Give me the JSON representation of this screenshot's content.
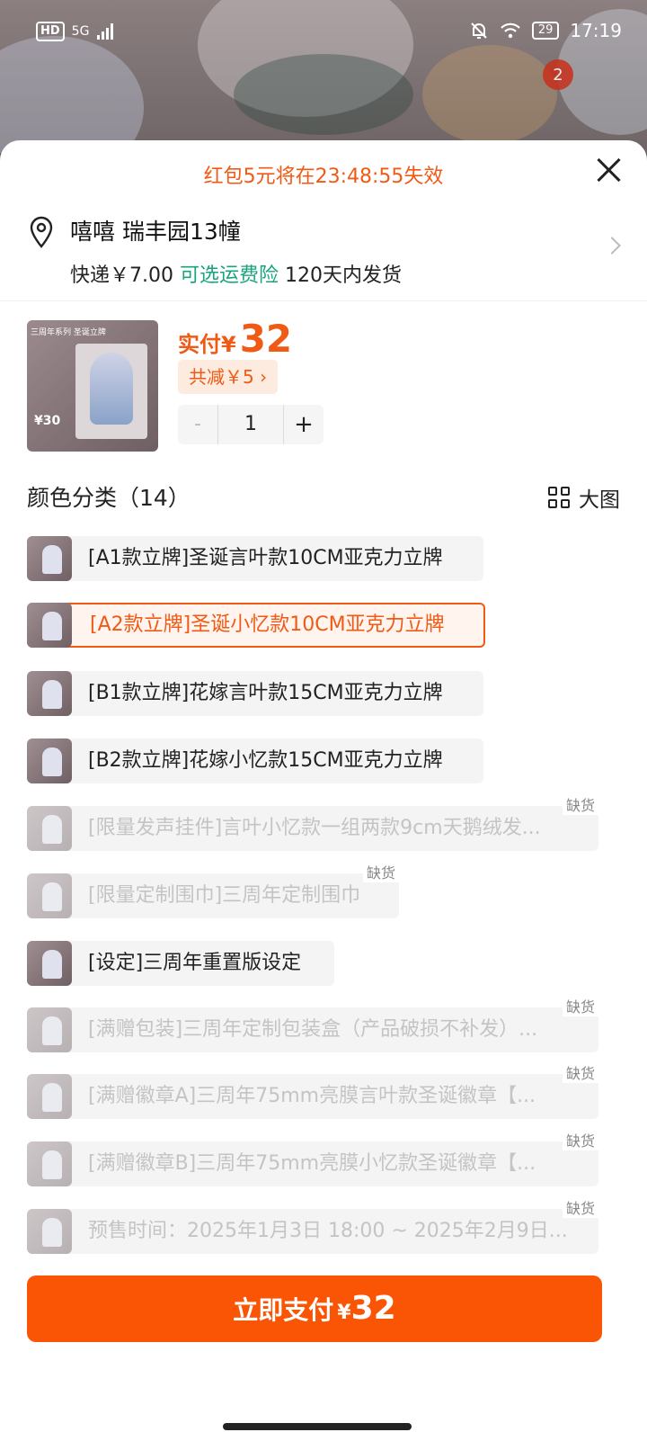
{
  "status_bar": {
    "network_hd": "HD",
    "network_type": "5G",
    "battery": "29",
    "time": "17:19",
    "notification_badge": "2"
  },
  "coupon_notice": "红包5元将在23:48:55失效",
  "address": {
    "name_and_place": "嘻嘻 瑞丰园13幢",
    "shipping_fee": "快递￥7.00",
    "insurance": "可选运费险",
    "dispatch": "120天内发货"
  },
  "product": {
    "thumb_title": "三周年系列 圣诞立牌",
    "thumb_price": "¥30",
    "price_label": "实付",
    "currency": "¥",
    "price": "32",
    "discount": "共减￥5 ›",
    "quantity": "1",
    "minus": "-",
    "plus": "+"
  },
  "variants": {
    "title": "颜色分类（14）",
    "big_view_label": "大图",
    "items": [
      {
        "label": "[A1款立牌]圣诞言叶款10CM亚克力立牌",
        "state": "normal"
      },
      {
        "label": "[A2款立牌]圣诞小忆款10CM亚克力立牌",
        "state": "selected"
      },
      {
        "label": "[B1款立牌]花嫁言叶款15CM亚克力立牌",
        "state": "normal"
      },
      {
        "label": "[B2款立牌]花嫁小忆款15CM亚克力立牌",
        "state": "normal"
      },
      {
        "label": "[限量发声挂件]言叶小忆款一组两款9cm天鹅绒发...",
        "state": "out",
        "tag": "缺货"
      },
      {
        "label": "[限量定制围巾]三周年定制围巾",
        "state": "out",
        "tag": "缺货"
      },
      {
        "label": "[设定]三周年重置版设定",
        "state": "normal"
      },
      {
        "label": "[满赠包装]三周年定制包装盒（产品破损不补发）...",
        "state": "out",
        "tag": "缺货"
      },
      {
        "label": "[满赠徽章A]三周年75mm亮膜言叶款圣诞徽章【...",
        "state": "out",
        "tag": "缺货"
      },
      {
        "label": "[满赠徽章B]三周年75mm亮膜小忆款圣诞徽章【...",
        "state": "out",
        "tag": "缺货"
      },
      {
        "label": "预售时间：2025年1月3日 18:00 ~ 2025年2月9日...",
        "state": "out",
        "tag": "缺货"
      }
    ]
  },
  "pay_button": {
    "text": "立即支付",
    "currency": "¥",
    "amount": "32"
  },
  "colors": {
    "accent": "#f05a14",
    "pay_button": "#fa5505",
    "insurance_green": "#1aa37d"
  }
}
